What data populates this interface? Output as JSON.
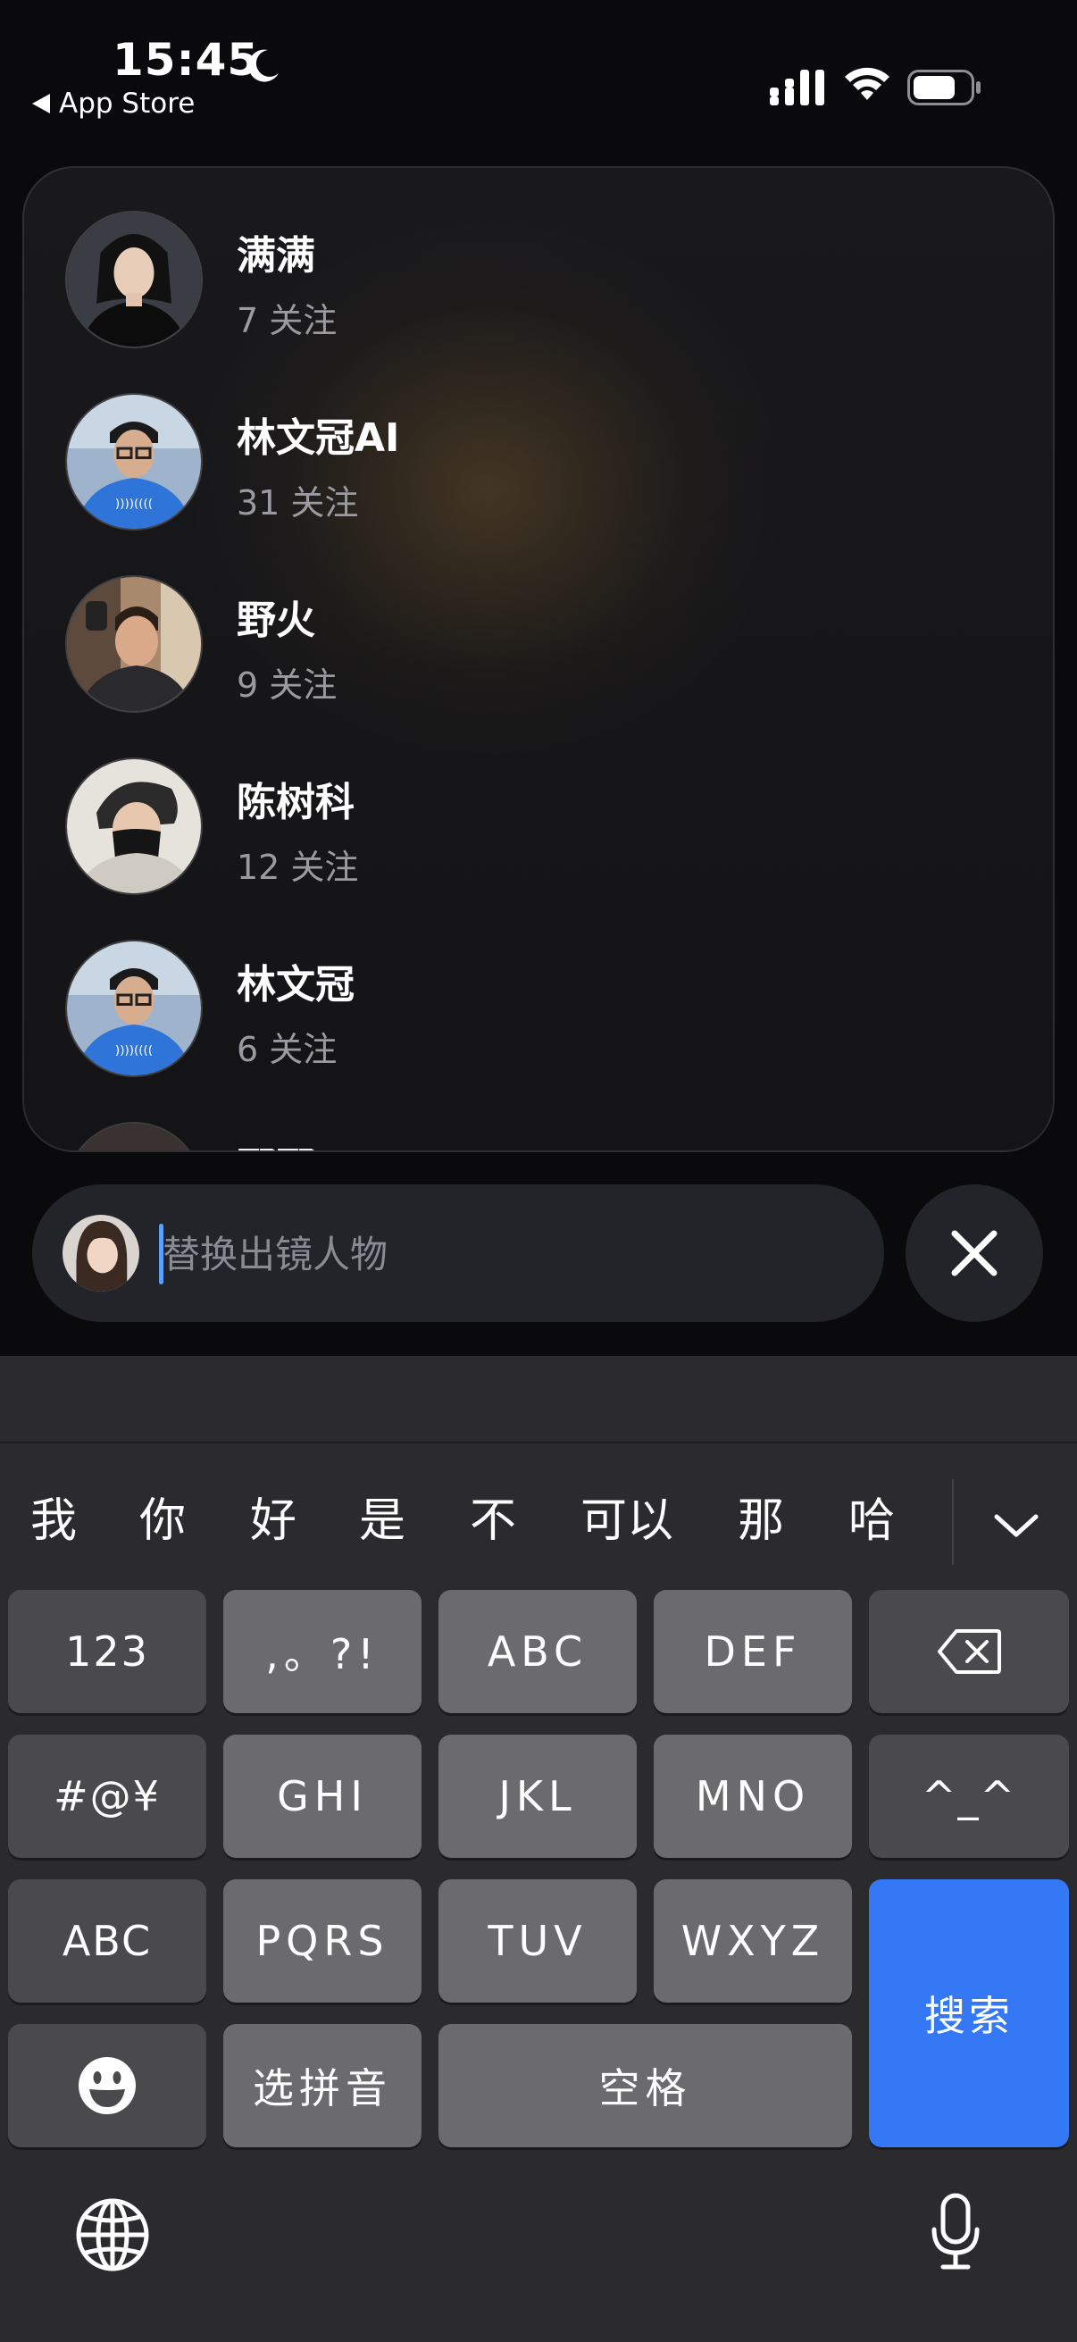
{
  "status_bar": {
    "time": "15:45",
    "back_label": "App Store"
  },
  "results": [
    {
      "name": "满满",
      "follow": "7 关注",
      "avatar": "woman-black-dress"
    },
    {
      "name": "林文冠AI",
      "follow": "31 关注",
      "avatar": "man-blue-shirt-glasses"
    },
    {
      "name": "野火",
      "follow": "9 关注",
      "avatar": "man-mirror-selfie"
    },
    {
      "name": "陈树科",
      "follow": "12 关注",
      "avatar": "man-black-mask"
    },
    {
      "name": "林文冠",
      "follow": "6 关注",
      "avatar": "man-blue-shirt-glasses"
    },
    {
      "name": "邢邢",
      "follow": "",
      "avatar": "dark-hair-partial"
    }
  ],
  "search": {
    "placeholder": "替换出镜人物",
    "value": ""
  },
  "candidates": [
    "我",
    "你",
    "好",
    "是",
    "不",
    "可以",
    "那",
    "哈"
  ],
  "keyboard": {
    "row1": [
      "123",
      ",。?!",
      "ABC",
      "DEF"
    ],
    "row2": [
      "#@¥",
      "GHI",
      "JKL",
      "MNO",
      "^_^"
    ],
    "row3": [
      "ABC",
      "PQRS",
      "TUV",
      "WXYZ"
    ],
    "row4_pinyin": "选拼音",
    "space": "空格",
    "search": "搜索"
  },
  "colors": {
    "accent_blue": "#3478f6",
    "key_light": "#6b6b6e",
    "key_dark": "#4a4a4d"
  }
}
